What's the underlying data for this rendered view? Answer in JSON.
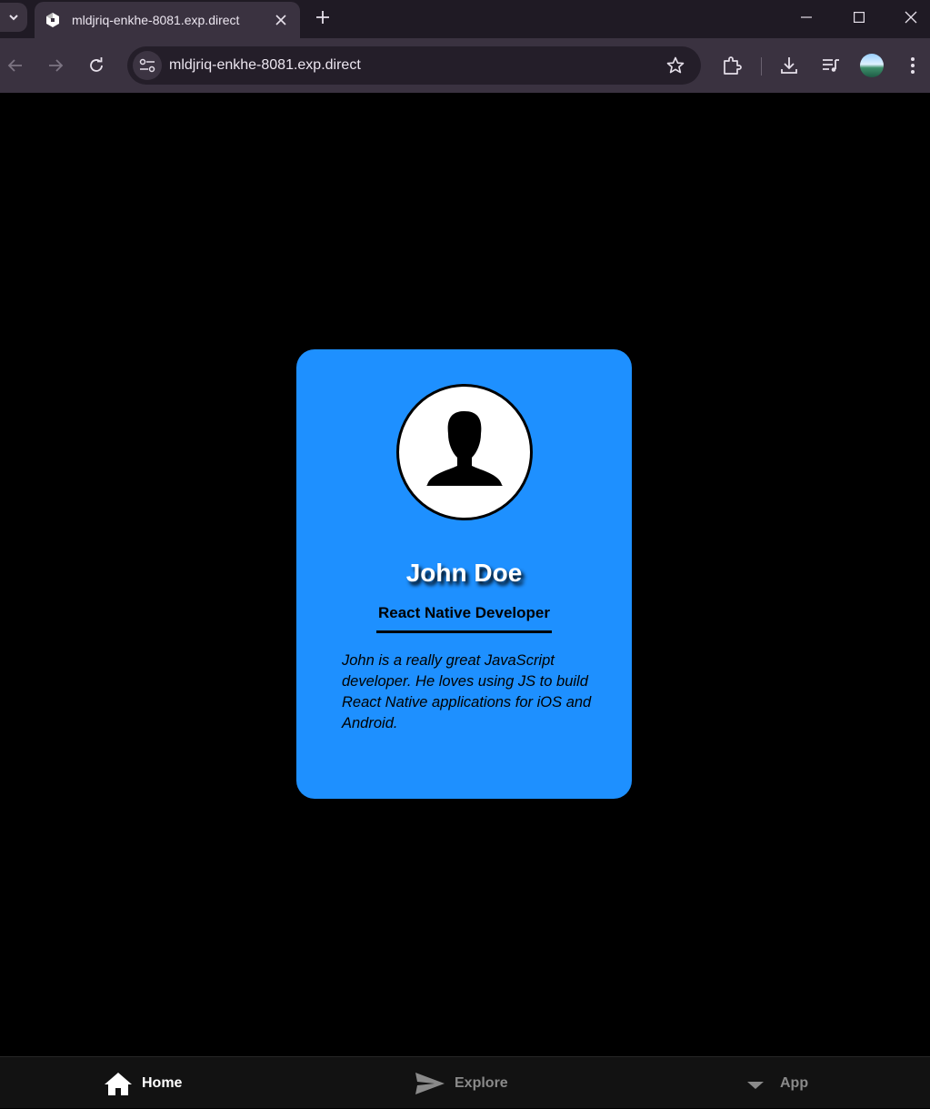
{
  "browser": {
    "tab_title": "mldjriq-enkhe-8081.exp.direct",
    "url": "mldjriq-enkhe-8081.exp.direct"
  },
  "profile": {
    "name": "John Doe",
    "role": "React Native Developer",
    "bio": "John is a really great JavaScript developer. He loves using JS to build React Native applications for iOS and Android.",
    "card_color": "#1e90ff"
  },
  "bottom_tabs": [
    {
      "label": "Home",
      "icon": "home-icon",
      "active": true
    },
    {
      "label": "Explore",
      "icon": "send-icon",
      "active": false
    },
    {
      "label": "App",
      "icon": "chevron-down-icon",
      "active": false
    }
  ]
}
